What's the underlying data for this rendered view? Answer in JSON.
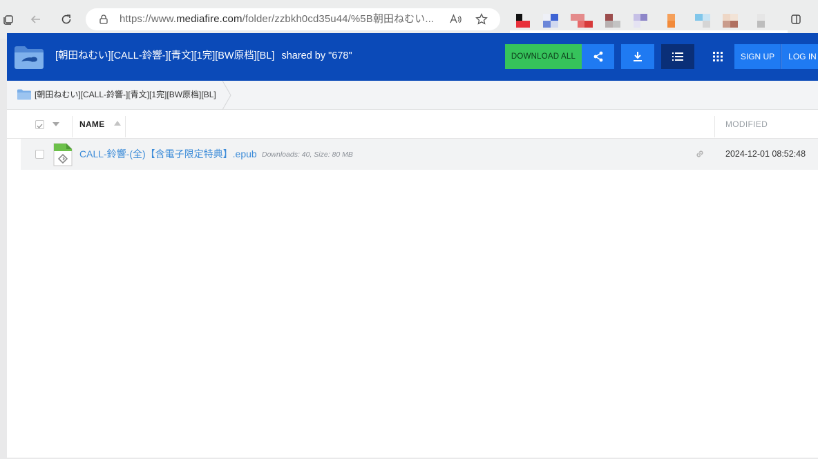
{
  "browser": {
    "url_prefix": "https://www.",
    "url_domain": "mediafire.com",
    "url_path": "/folder/zzbkh0cd35u44/%5B朝田ねむい..."
  },
  "header": {
    "title": "[朝田ねむい][CALL-鈴響-][青文][1完][BW原档][BL]",
    "shared_by": "shared by \"678\"",
    "download_all_label": "DOWNLOAD ALL",
    "sign_up_label": "SIGN UP",
    "log_in_label": "LOG IN"
  },
  "breadcrumb": {
    "label": "[朝田ねむい][CALL-鈴響-][青文][1完][BW原档][BL]"
  },
  "columns": {
    "name": "NAME",
    "modified": "MODIFIED"
  },
  "files": [
    {
      "name": "CALL-鈴響-(全)【含電子限定特典】.epub",
      "meta": "Downloads: 40, Size: 80 MB",
      "modified": "2024-12-01 08:52:48"
    }
  ],
  "colors": {
    "header_bg": "#0b4ab8",
    "download_all": "#36c35b",
    "button_blue": "#1f7af2",
    "link_blue": "#3b8bd8"
  },
  "icons": [
    "tabs-icon",
    "back-icon",
    "reload-icon",
    "lock-icon",
    "read-aloud-icon",
    "favorite-star-icon",
    "split-screen-icon",
    "folder-logo-icon",
    "share-icon",
    "download-icon",
    "list-view-icon",
    "grid-view-icon",
    "folder-icon",
    "checkbox-icon",
    "caret-down-icon",
    "sort-up-icon",
    "epub-file-icon",
    "link-icon"
  ]
}
